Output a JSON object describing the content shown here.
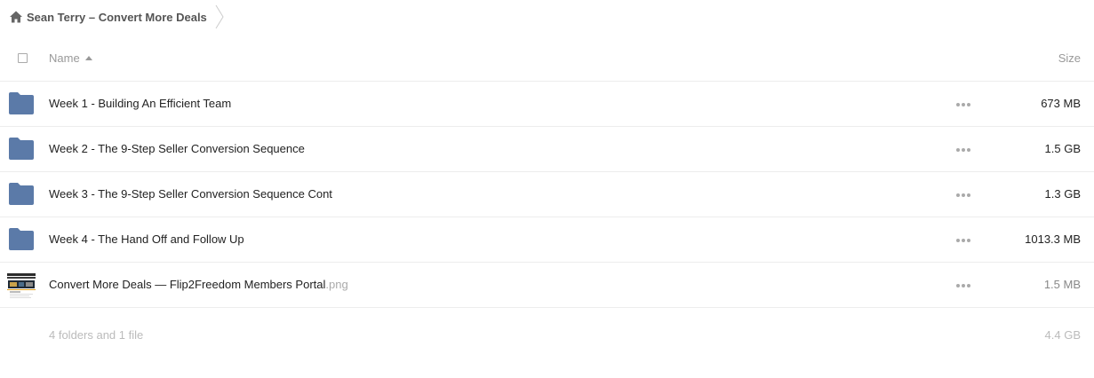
{
  "breadcrumb": {
    "home_icon": "home-icon",
    "label": "Sean Terry – Convert More Deals"
  },
  "header": {
    "name_label": "Name",
    "size_label": "Size",
    "sort": "ascending"
  },
  "colors": {
    "folder": "#5b7aa8",
    "border": "#ededed",
    "muted_text": "#999999"
  },
  "items": [
    {
      "type": "folder",
      "icon": "folder-icon",
      "name": "Week 1 - Building An Efficient Team",
      "size": "673 MB"
    },
    {
      "type": "folder",
      "icon": "folder-icon",
      "name": "Week 2 - The 9-Step Seller Conversion Sequence",
      "size": "1.5 GB"
    },
    {
      "type": "folder",
      "icon": "folder-icon",
      "name": "Week 3 - The 9-Step Seller Conversion Sequence Cont",
      "size": "1.3 GB"
    },
    {
      "type": "folder",
      "icon": "folder-icon",
      "name": "Week 4 - The Hand Off and Follow Up",
      "size": "1013.3 MB"
    },
    {
      "type": "file",
      "icon": "image-thumbnail",
      "name": "Convert More Deals — Flip2Freedom Members Portal",
      "ext": ".png",
      "size": "1.5 MB"
    }
  ],
  "summary": {
    "counts": "4 folders and 1 file",
    "total": "4.4 GB"
  }
}
